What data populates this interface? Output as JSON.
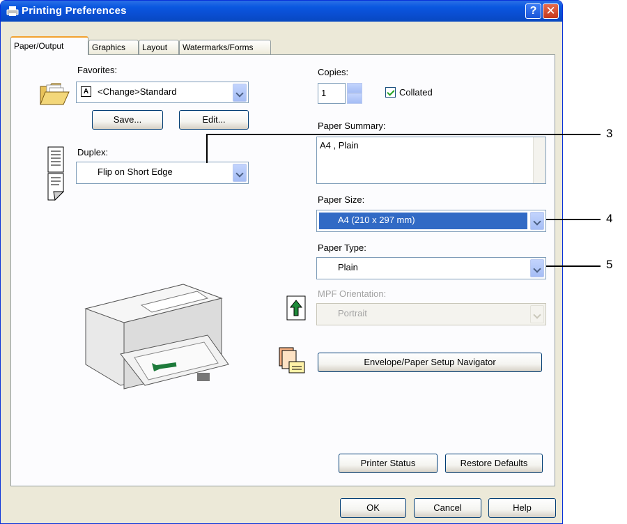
{
  "window": {
    "title": "Printing Preferences",
    "help_glyph": "?",
    "close_glyph": "✕"
  },
  "tabs": [
    "Paper/Output",
    "Graphics",
    "Layout",
    "Watermarks/Forms"
  ],
  "favorites": {
    "label": "Favorites:",
    "value": "<Change>Standard",
    "save_label": "Save...",
    "edit_label": "Edit..."
  },
  "duplex": {
    "label": "Duplex:",
    "value": "Flip on Short Edge"
  },
  "copies": {
    "label": "Copies:",
    "value": "1",
    "collated_label": "Collated",
    "collated_checked": true
  },
  "paper_summary": {
    "label": "Paper Summary:",
    "value": "A4 , Plain"
  },
  "paper_size": {
    "label": "Paper Size:",
    "value": "A4 (210 x 297 mm)"
  },
  "paper_type": {
    "label": "Paper Type:",
    "value": "Plain"
  },
  "mpf_orientation": {
    "label": "MPF Orientation:",
    "value": "Portrait"
  },
  "envelope_button": "Envelope/Paper Setup Navigator",
  "printer_status_button": "Printer Status",
  "restore_defaults_button": "Restore Defaults",
  "footer": {
    "ok": "OK",
    "cancel": "Cancel",
    "help": "Help"
  },
  "callouts": [
    "3",
    "4",
    "5"
  ],
  "colors": {
    "title_bar": "#0a58e0",
    "selection": "#316ac5",
    "dialog_bg": "#ece9d8",
    "tab_accent": "#f2a12e"
  },
  "icons": [
    "printer-icon",
    "folder-icon",
    "duplex-document-icon",
    "printer-illustration",
    "orientation-arrow-icon",
    "envelope-navigator-icon"
  ]
}
